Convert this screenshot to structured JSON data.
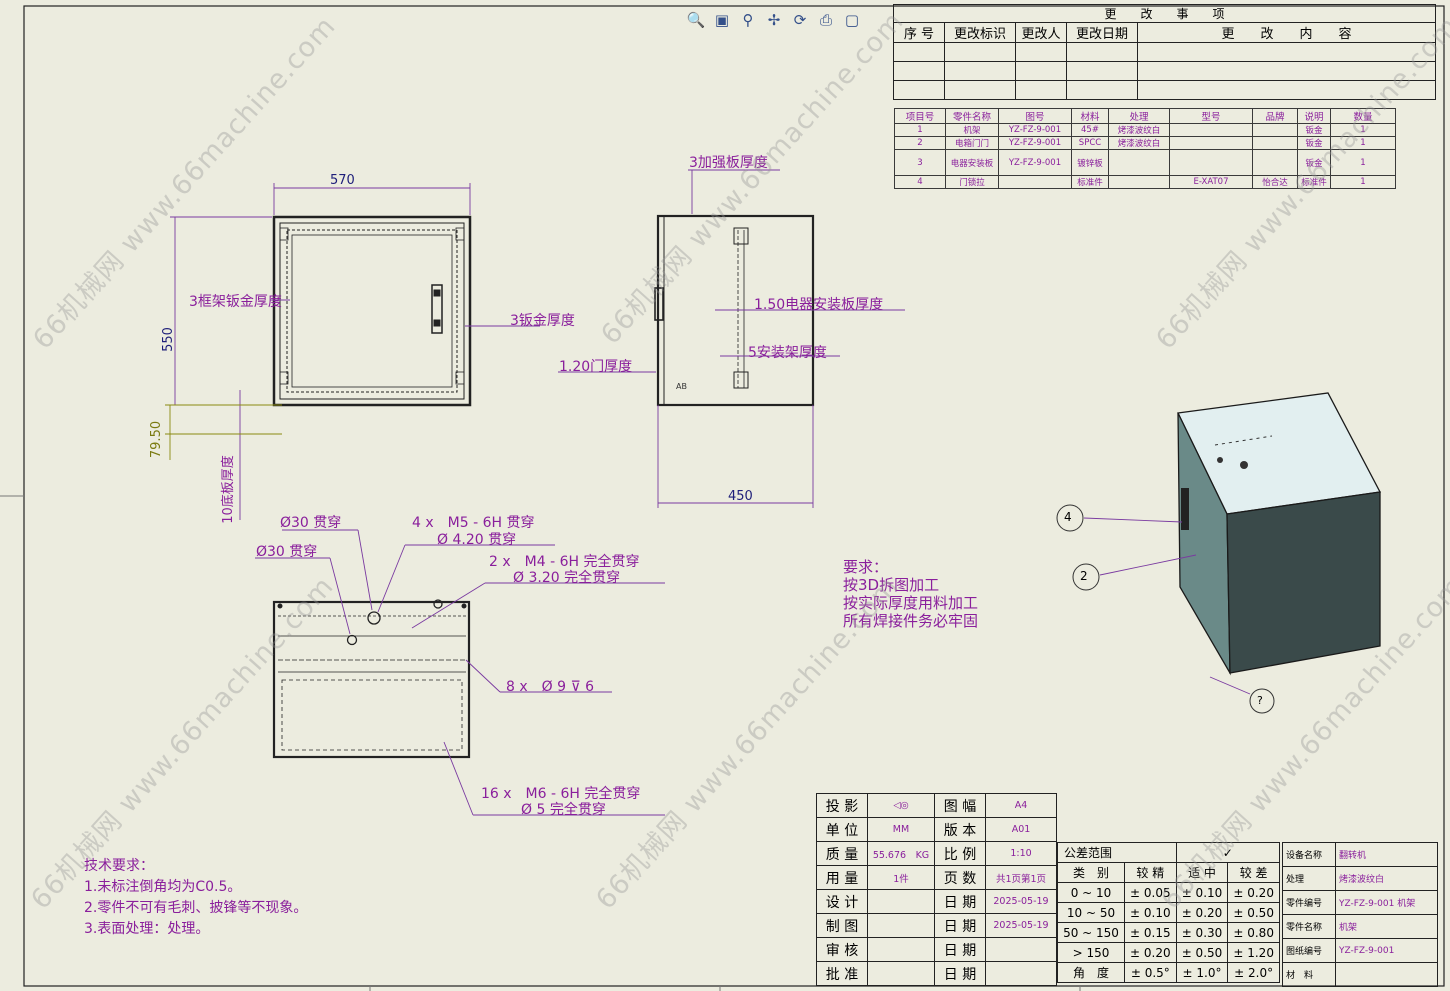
{
  "toolbar": {
    "icons": [
      "zoom-in-icon",
      "zoom-fit-icon",
      "zoom-area-icon",
      "pan-icon",
      "rotate-icon",
      "print-icon",
      "view-cube-icon"
    ]
  },
  "change_table": {
    "title": "更　　改　　事　　项",
    "headers": [
      "序 号",
      "更改标识",
      "更改人",
      "更改日期",
      "更　　改　　内　　容"
    ]
  },
  "bom": {
    "headers": [
      "项目号",
      "零件名称",
      "图号",
      "材料",
      "处理",
      "型号",
      "品牌",
      "说明",
      "数量"
    ],
    "rows": [
      [
        "1",
        "机架",
        "YZ-FZ-9-001",
        "45#",
        "烤漆波纹白",
        "",
        "",
        "钣金",
        "1"
      ],
      [
        "2",
        "电箱门门",
        "YZ-FZ-9-001",
        "SPCC",
        "烤漆波纹白",
        "",
        "",
        "钣金",
        "1"
      ],
      [
        "3",
        "电器安装板",
        "YZ-FZ-9-001",
        "镀锌板",
        "",
        "",
        "",
        "钣金",
        "1"
      ],
      [
        "4",
        "门锁拉",
        "",
        "标准件",
        "",
        "E-XAT07",
        "怡合达",
        "标准件",
        "1"
      ]
    ]
  },
  "dims": {
    "front_width": "570",
    "front_height": "550",
    "base_height": "79.50",
    "base_thickness": "10底板厚度",
    "frame_thickness": "3框架钣金厚度",
    "sheet_thickness": "3钣金厚度",
    "side_width": "450",
    "rib_thickness": "3加强板厚度",
    "plate_thickness": "1.50电器安装板厚度",
    "bracket_thickness": "5安装架厚度",
    "door_thickness": "1.20门厚度",
    "side_mark": "AB"
  },
  "holes": {
    "h1": "Ø30 贯穿",
    "h2": "Ø30 贯穿",
    "h3a": "4 x　M5 - 6H 贯穿",
    "h3b": "Ø 4.20 贯穿",
    "h4a": "2 x　M4 - 6H 完全贯穿",
    "h4b": "Ø 3.20 完全贯穿",
    "h5": "8 x　Ø 9 ⊽ 6",
    "h6a": "16 x　M6 - 6H 完全贯穿",
    "h6b": "Ø 5 完全贯穿"
  },
  "requirements": {
    "title": "要求：",
    "lines": [
      "按3D拆图加工",
      "按实际厚度用料加工",
      "所有焊接件务必牢固"
    ]
  },
  "tech": {
    "title": "技术要求：",
    "lines": [
      "1.未标注倒角均为C0.5。",
      "2.零件不可有毛刺、披锋等不现象。",
      "3.表面处理：处理。"
    ]
  },
  "balloons": [
    "4",
    "2",
    "?"
  ],
  "title_block": {
    "rows": [
      [
        "投 影",
        "",
        "图 幅",
        "A4"
      ],
      [
        "单 位",
        "MM",
        "版 本",
        "A01"
      ],
      [
        "质 量",
        "55.676　KG",
        "比 例",
        "1:10"
      ],
      [
        "用 量",
        "1件",
        "页 数",
        "共1页第1页"
      ],
      [
        "设 计",
        "",
        "日 期",
        "2025-05-19"
      ],
      [
        "制 图",
        "",
        "日 期",
        "2025-05-19"
      ],
      [
        "审 核",
        "",
        "日 期",
        ""
      ],
      [
        "批 准",
        "",
        "日 期",
        ""
      ]
    ]
  },
  "tolerance": {
    "title": "公差范围",
    "headers": [
      "类　别",
      "较 精",
      "适 中",
      "较 差"
    ],
    "rows": [
      [
        "0 ~ 10",
        "± 0.05",
        "± 0.10",
        "± 0.20"
      ],
      [
        "10 ~ 50",
        "± 0.10",
        "± 0.20",
        "± 0.50"
      ],
      [
        "50 ~ 150",
        "± 0.15",
        "± 0.30",
        "± 0.80"
      ],
      [
        "> 150",
        "± 0.20",
        "± 0.50",
        "± 1.20"
      ],
      [
        "角　度",
        "± 0.5°",
        "± 1.0°",
        "± 2.0°"
      ]
    ]
  },
  "info_block": {
    "rows": [
      [
        "设备名称",
        "翻转机"
      ],
      [
        "处理",
        "烤漆波纹白"
      ],
      [
        "零件编号",
        "YZ-FZ-9-001 机架"
      ],
      [
        "零件名称",
        "机架"
      ],
      [
        "图纸编号",
        "YZ-FZ-9-001"
      ],
      [
        "材　料",
        ""
      ]
    ]
  },
  "watermark": "66机械网 www.66machine.com"
}
